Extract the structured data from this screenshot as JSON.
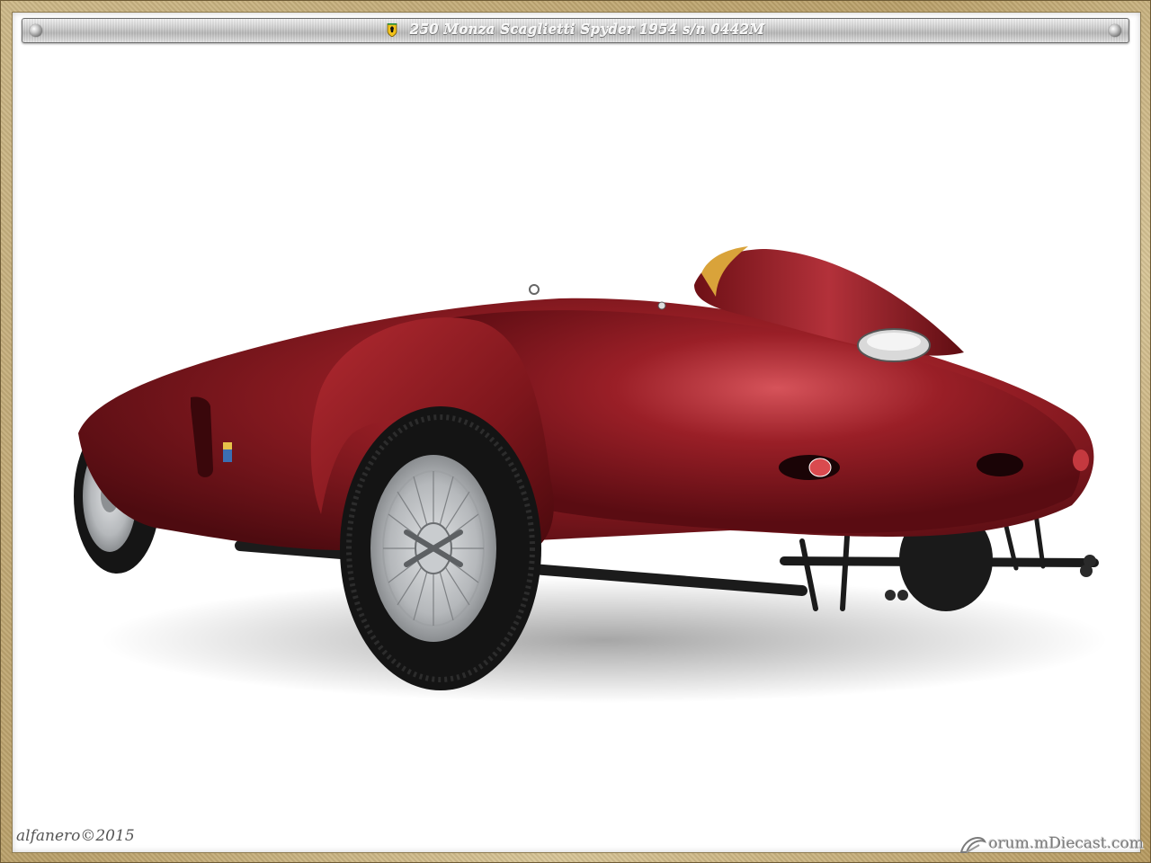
{
  "title_bar": {
    "badge_icon": "prancing-horse-shield-icon",
    "title": "250 Monza Scaglietti Spyder 1954  s/n 0442M"
  },
  "photo": {
    "subject_color": "#8e1a1f",
    "wheel_color": "#b9bcbf"
  },
  "credit": "alfanero©2015",
  "watermark": {
    "icon": "forum-logo-icon",
    "text": "orum.mDiecast.com"
  },
  "colors": {
    "frame_gold": "#c2a871",
    "title_bar_silver": "#c9c9c9"
  }
}
